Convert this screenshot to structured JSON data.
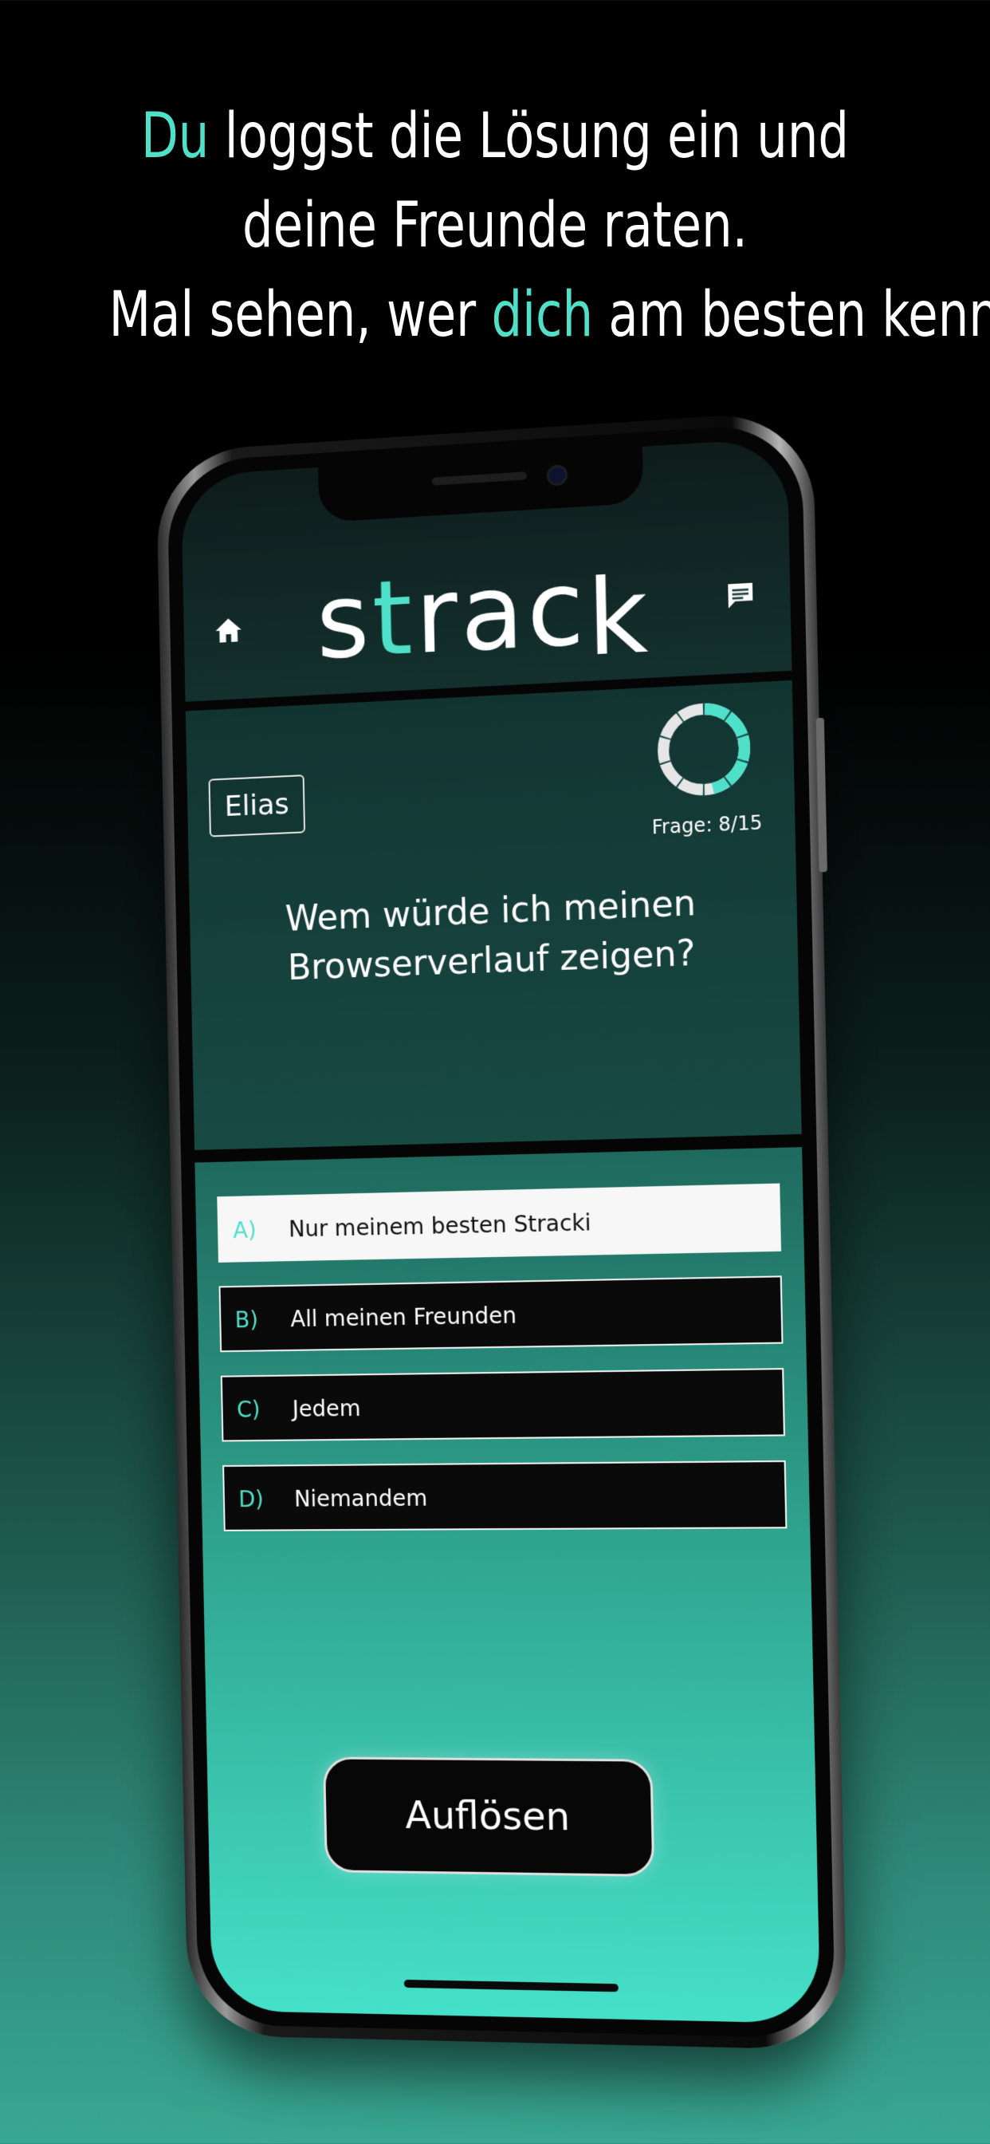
{
  "headline": {
    "line1_accent": "Du",
    "line1_rest": " loggst die Lösung ein und",
    "line2": "deine Freunde raten.",
    "line3_pre": "Mal sehen, wer ",
    "line3_accent": "dich",
    "line3_post": " am besten kennt."
  },
  "app": {
    "logo_s": "s",
    "logo_t": "t",
    "logo_rac": "rac",
    "logo_k": "k",
    "home_icon": "home-icon",
    "chat_icon": "chat-icon"
  },
  "quiz": {
    "player_name": "Elias",
    "progress_label": "Frage: 8/15",
    "question_current": 8,
    "question_total": 15,
    "question_line1": "Wem würde ich meinen",
    "question_line2": "Browserverlauf zeigen?",
    "answers": [
      {
        "letter": "A)",
        "text": "Nur meinem besten Stracki",
        "selected": true
      },
      {
        "letter": "B)",
        "text": "All meinen Freunden",
        "selected": false
      },
      {
        "letter": "C)",
        "text": "Jedem",
        "selected": false
      },
      {
        "letter": "D)",
        "text": "Niemandem",
        "selected": false
      }
    ],
    "resolve_label": "Auflösen"
  },
  "colors": {
    "accent": "#4fe0c9",
    "timer_track": "#e6e6e6",
    "background": "#000000"
  }
}
